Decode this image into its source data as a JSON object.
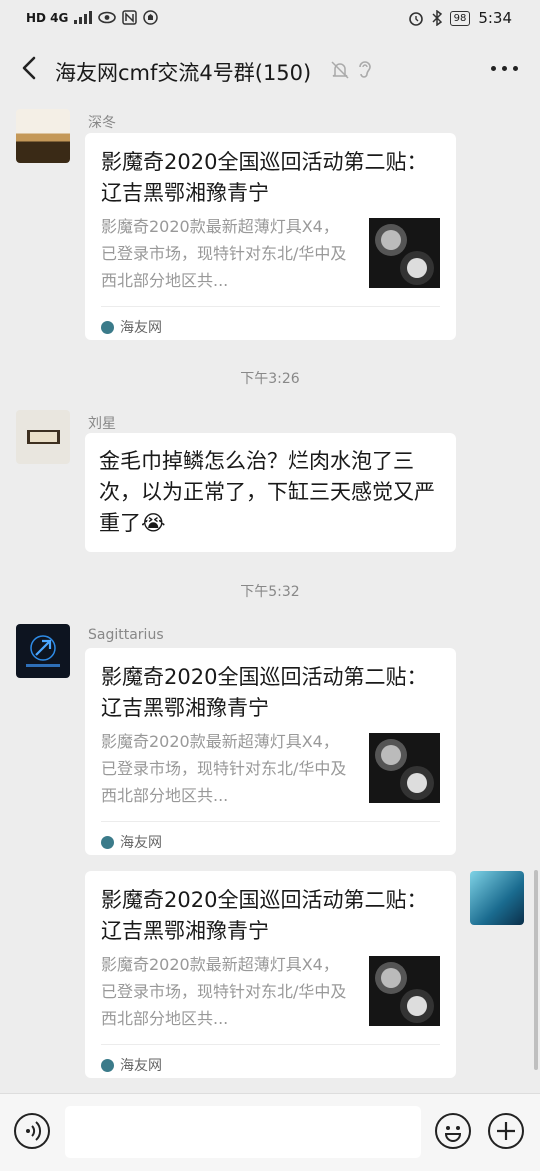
{
  "status_bar": {
    "signal_text": "HD 4G",
    "battery": "98",
    "time": "5:34"
  },
  "header": {
    "title": "海友网cmf交流4号群(150)"
  },
  "messages": {
    "m1": {
      "sender": "深冬",
      "card_title": "影魔奇2020全国巡回活动第二贴： 辽吉黑鄂湘豫青宁",
      "card_desc": "影魔奇2020款最新超薄灯具X4，已登录市场，现特针对东北/华中及西北部分地区共...",
      "source": "海友网"
    },
    "time1": "下午3:26",
    "m2": {
      "sender": "刘星",
      "text": "金毛巾掉鳞怎么治？烂肉水泡了三次，以为正常了，下缸三天感觉又严重了😭"
    },
    "time2": "下午5:32",
    "m3": {
      "sender": "Sagittarius",
      "card_title": "影魔奇2020全国巡回活动第二贴： 辽吉黑鄂湘豫青宁",
      "card_desc": "影魔奇2020款最新超薄灯具X4，已登录市场，现特针对东北/华中及西北部分地区共...",
      "source": "海友网"
    },
    "m4": {
      "card_title": "影魔奇2020全国巡回活动第二贴： 辽吉黑鄂湘豫青宁",
      "card_desc": "影魔奇2020款最新超薄灯具X4，已登录市场，现特针对东北/华中及西北部分地区共...",
      "source": "海友网"
    }
  },
  "input": {
    "placeholder": ""
  },
  "icons": {
    "back": "back-arrow-icon",
    "mute": "mute-bell-icon",
    "earpiece": "ear-icon",
    "more": "more-dots-icon",
    "voice": "voice-icon",
    "emoji": "emoji-icon",
    "plus": "plus-icon",
    "source": "haiyou-logo-icon"
  },
  "colors": {
    "background": "#ededed",
    "bubble": "#ffffff",
    "muted_text": "#999999"
  }
}
